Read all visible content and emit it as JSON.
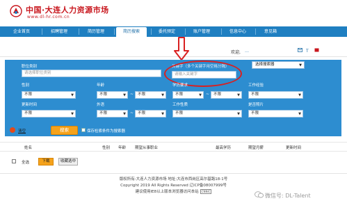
{
  "header": {
    "title": "中国·大连人力资源市场",
    "url": "www.dl-hr.com.cn",
    "brand_color": "#c8161d"
  },
  "nav": {
    "items": [
      {
        "label": "企业首页"
      },
      {
        "label": "招聘管理"
      },
      {
        "label": "简历管理"
      },
      {
        "label": "简历搜索"
      },
      {
        "label": "委托预定"
      },
      {
        "label": "账户管理"
      },
      {
        "label": "信息中心"
      },
      {
        "label": "意见箱"
      }
    ],
    "active_index": 3,
    "bar_color": "#1f7fc1"
  },
  "welcome": {
    "text": "欢迎,",
    "link_tail": "…",
    "notice": "T"
  },
  "search": {
    "position_label": "职位类别",
    "position_placeholder": "请选择职位类别",
    "keyword_label": "关键字（多个关键字用空格分隔）",
    "keyword_placeholder": "请输入关键字",
    "search_selector": "选择搜索器",
    "gender_label": "性别",
    "gender_value": "不限",
    "age_label": "年龄",
    "age_from": "不限",
    "age_to": "不限",
    "education_label": "学历要求",
    "edu_from": "不限",
    "edu_to": "不限",
    "experience_label": "工作经验",
    "experience_value": "不限",
    "update_label": "更新时间",
    "update_value": "不限",
    "language_label": "外语",
    "language_value": "不限",
    "language_level": "不限",
    "job_nature_label": "工作性质",
    "job_nature_value": "不限",
    "photo_label": "是否照片",
    "photo_value": "不限",
    "tilde": "~",
    "arrow": "▼",
    "panel_color": "#2d8dd0"
  },
  "actions": {
    "clear_label": "清空",
    "search_label": "搜索",
    "save_label": "保存检索条件为搜索器"
  },
  "table": {
    "columns": [
      "姓名",
      "性别",
      "年龄",
      "期望从事职业",
      "最高学历",
      "期望月薪",
      "更新时间"
    ]
  },
  "list_footer": {
    "all_label": "全选",
    "download_label": "下载",
    "collect_label": "收藏选中"
  },
  "footer": {
    "line1": "版权所有:大连人力资源市场  地址:大连市西岗区高尔基路18-1号",
    "line2": "Copyright 2019 All Rights Reserved  辽ICP备08007999号",
    "line3": "建议使用IE8以上版本浏览器访问本站",
    "badge": "CNNIC"
  },
  "watermark": {
    "text": "微信号: DL-Talent"
  },
  "annotations": {
    "highlight_color": "#d92020"
  }
}
